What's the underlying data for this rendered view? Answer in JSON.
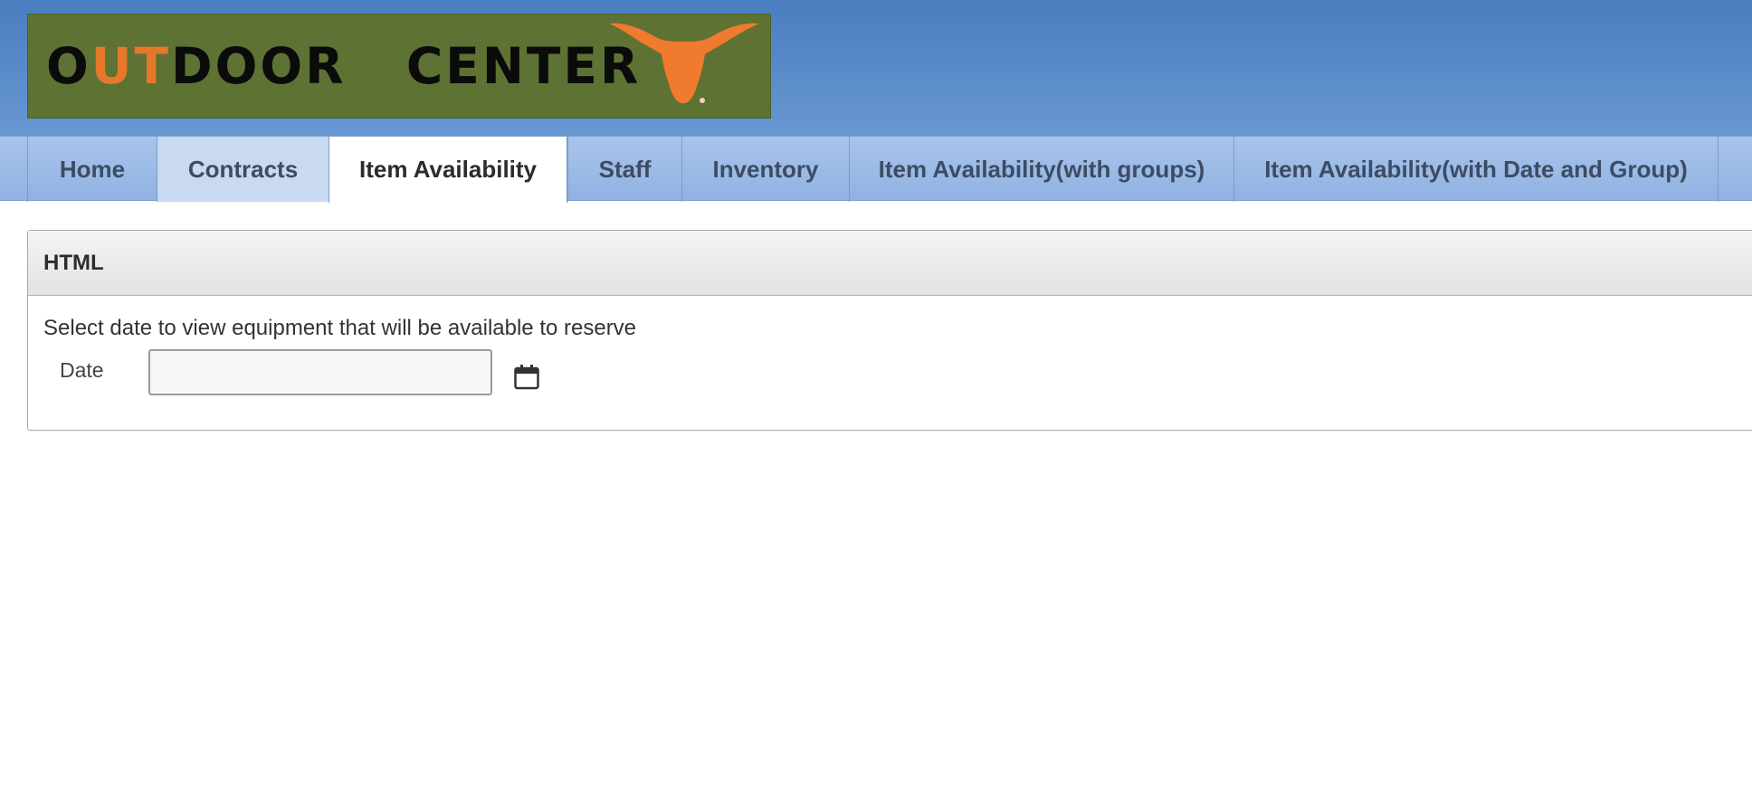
{
  "header": {
    "logo_text_part1": "O",
    "logo_text_accent": "UT",
    "logo_text_part2": "DOOR   CENTER",
    "logo_icon": "longhorn-icon",
    "colors": {
      "logo_bg": "#5e7234",
      "logo_accent": "#e5782a"
    }
  },
  "nav": {
    "tabs": [
      {
        "label": "Home"
      },
      {
        "label": "Contracts"
      },
      {
        "label": "Item Availability"
      },
      {
        "label": "Staff"
      },
      {
        "label": "Inventory"
      },
      {
        "label": "Item Availability(with groups)"
      },
      {
        "label": "Item Availability(with Date and Group)"
      }
    ],
    "active_tab": "Item Availability"
  },
  "panel": {
    "title": "HTML",
    "instruction": "Select date to view equipment that will be available to reserve",
    "date_label": "Date",
    "date_value": "",
    "calendar_icon": "calendar-icon"
  }
}
